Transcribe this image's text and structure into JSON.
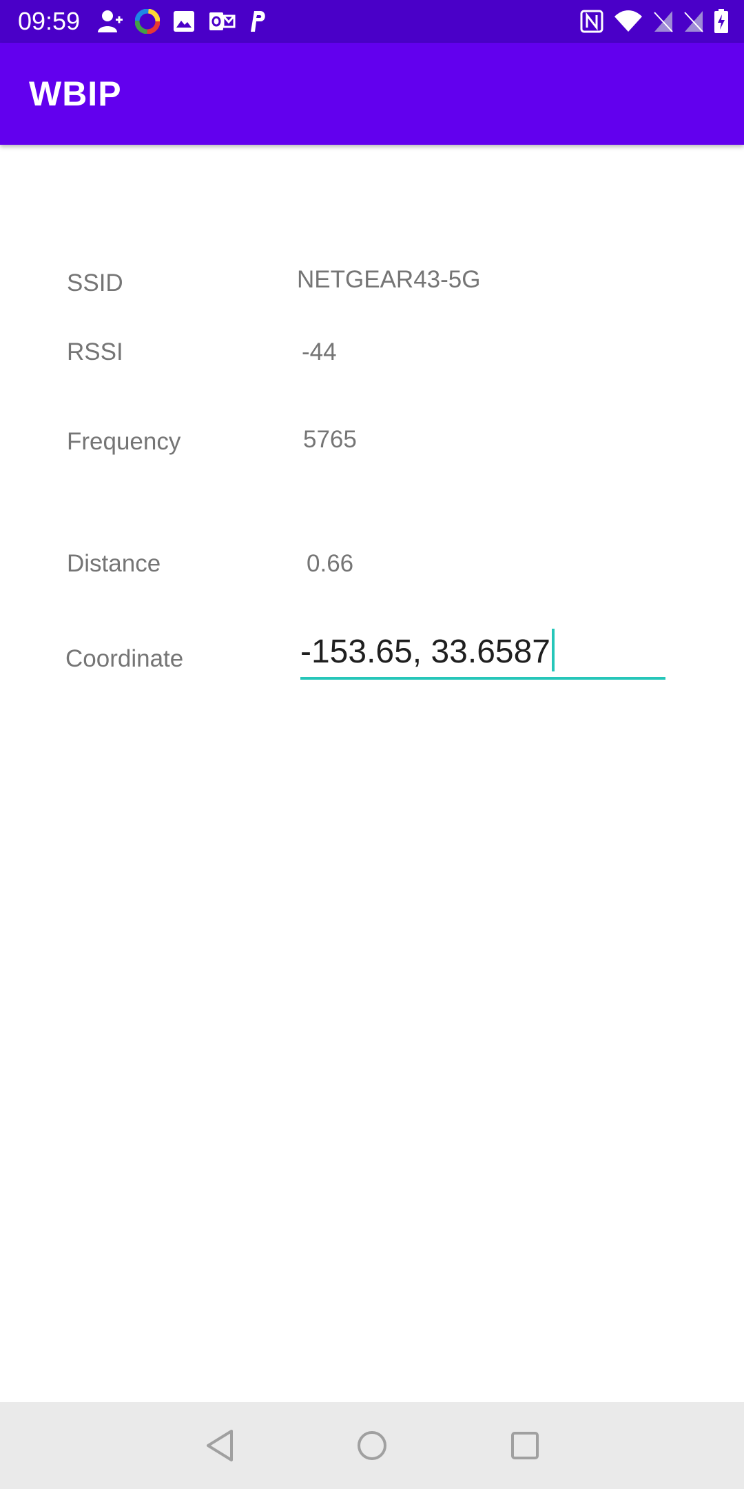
{
  "status_bar": {
    "time": "09:59",
    "left_icons": [
      "person-add-icon",
      "color-wheel-icon",
      "image-icon",
      "outlook-icon",
      "p-icon"
    ],
    "right_icons": [
      "nfc-icon",
      "wifi-icon",
      "signal-off-icon",
      "signal-off-icon",
      "battery-icon"
    ]
  },
  "app_bar": {
    "title": "WBIP",
    "color": "#6200ee"
  },
  "fields": {
    "ssid": {
      "label": "SSID",
      "value": "NETGEAR43-5G"
    },
    "rssi": {
      "label": "RSSI",
      "value": "-44"
    },
    "frequency": {
      "label": "Frequency",
      "value": "5765"
    },
    "distance": {
      "label": "Distance",
      "value": "0.66"
    },
    "coordinate": {
      "label": "Coordinate",
      "value": "-153.65, 33.6587"
    }
  },
  "accent_color": "#26c6b9",
  "nav_bar": {
    "buttons": [
      "back-icon",
      "home-icon",
      "recents-icon"
    ]
  }
}
